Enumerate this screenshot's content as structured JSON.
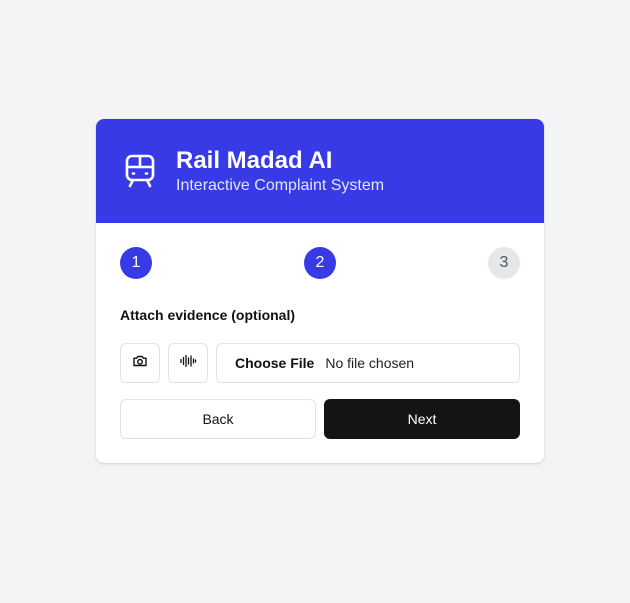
{
  "app": {
    "title": "Rail Madad AI",
    "subtitle": "Interactive Complaint System",
    "icon": "train-icon",
    "accent_color": "#383be5"
  },
  "steps": [
    {
      "label": "1",
      "state": "complete"
    },
    {
      "label": "2",
      "state": "current"
    },
    {
      "label": "3",
      "state": "upcoming"
    }
  ],
  "evidence": {
    "label": "Attach evidence (optional)",
    "camera_icon": "camera-icon",
    "audio_icon": "audio-waveform-icon",
    "file_button_label": "Choose File",
    "file_status": "No file chosen"
  },
  "actions": {
    "back_label": "Back",
    "next_label": "Next"
  }
}
